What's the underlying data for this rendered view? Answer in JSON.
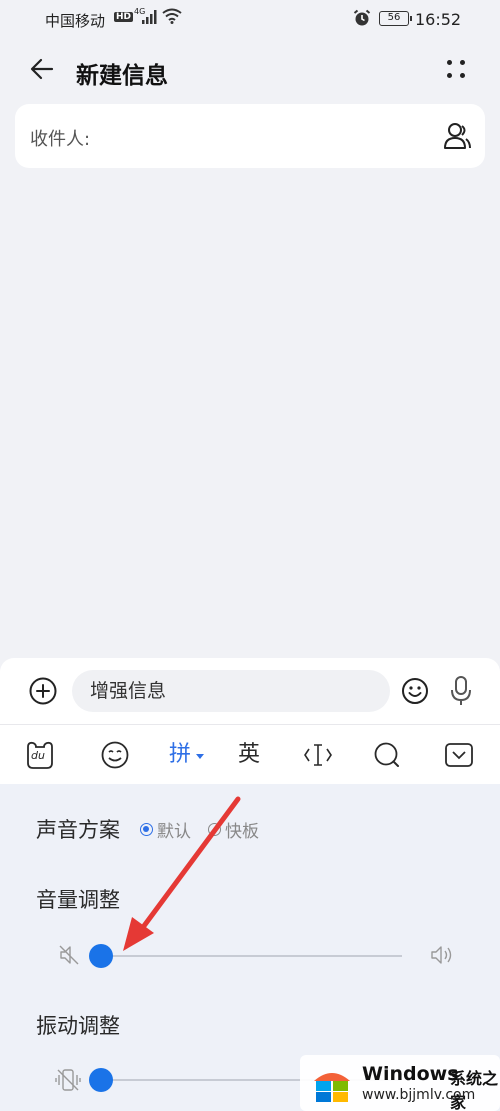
{
  "status_bar": {
    "carrier": "中国移动",
    "hd_badge": "HD",
    "network": "4G",
    "battery": "56",
    "time": "16:52"
  },
  "header": {
    "title": "新建信息"
  },
  "recipient": {
    "label": "收件人:"
  },
  "compose": {
    "placeholder": "增强信息"
  },
  "ime_toolbar": {
    "logo_label": "du",
    "pinyin_label": "拼",
    "english_label": "英"
  },
  "settings": {
    "sound_scheme_label": "声音方案",
    "sound_options": [
      {
        "label": "默认",
        "checked": true
      },
      {
        "label": "快板",
        "checked": false
      }
    ],
    "volume_label": "音量调整",
    "volume_level": 0,
    "vibration_label": "振动调整",
    "vibration_level": 0
  },
  "watermark": {
    "brand": "Windows",
    "brand_cn": "系统之家",
    "url": "www.bjjmlv.com"
  },
  "colors": {
    "accent": "#1a73e8",
    "arrow": "#e53935",
    "background": "#f1f2f6"
  }
}
